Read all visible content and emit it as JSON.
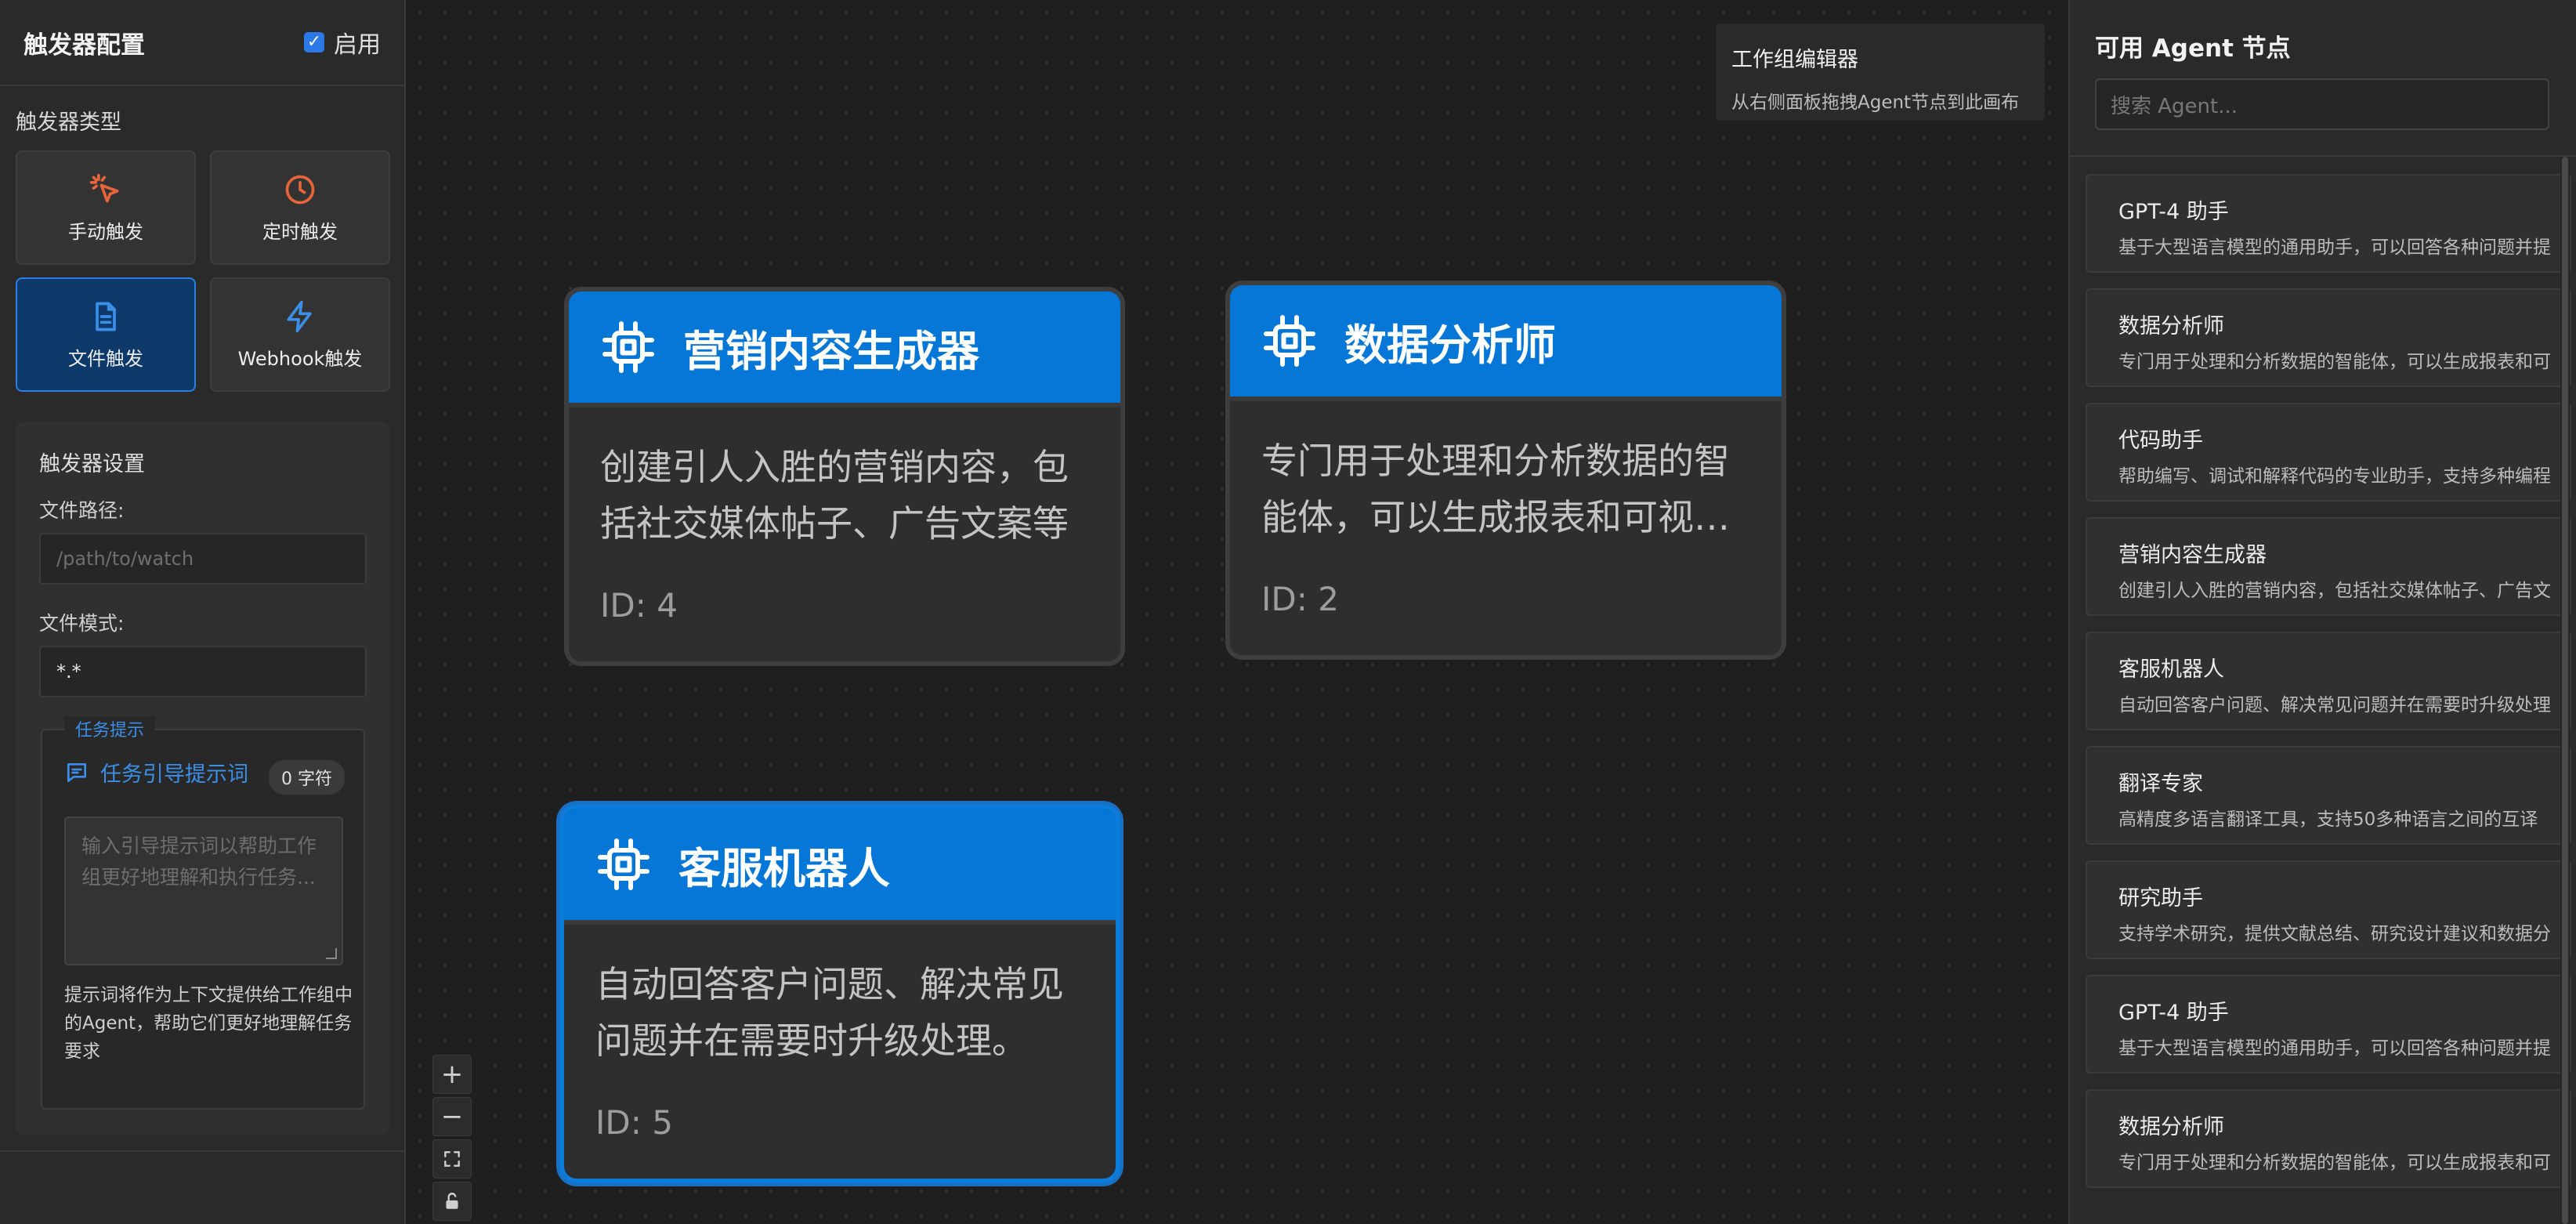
{
  "left_panel": {
    "title": "触发器配置",
    "enable_label": "启用",
    "trigger_type_label": "触发器类型",
    "triggers": [
      {
        "label": "手动触发",
        "icon": "cursor-click-icon",
        "color": "#e8643a"
      },
      {
        "label": "定时触发",
        "icon": "clock-icon",
        "color": "#e8643a"
      },
      {
        "label": "文件触发",
        "icon": "file-icon",
        "color": "#3b8fe8"
      },
      {
        "label": "Webhook触发",
        "icon": "bolt-icon",
        "color": "#3b8fe8"
      }
    ],
    "settings": {
      "title": "触发器设置",
      "file_path_label": "文件路径:",
      "file_path_placeholder": "/path/to/watch",
      "file_pattern_label": "文件模式:",
      "file_pattern_value": "*.*",
      "prompt": {
        "tag": "任务提示",
        "label": "任务引导提示词",
        "char_count": "0 字符",
        "placeholder": "输入引导提示词以帮助工作组更好地理解和执行任务...",
        "help": "提示词将作为上下文提供给工作组中的Agent，帮助它们更好地理解任务要求"
      }
    }
  },
  "canvas": {
    "tip": {
      "title": "工作组编辑器",
      "subtitle": "从右侧面板拖拽Agent节点到此画布"
    },
    "nodes": [
      {
        "title": "营销内容生成器",
        "description": "创建引人入胜的营销内容，包括社交媒体帖子、广告文案等",
        "id": "ID: 4"
      },
      {
        "title": "数据分析师",
        "description": "专门用于处理和分析数据的智能体，可以生成报表和可视化图表",
        "id": "ID: 2"
      },
      {
        "title": "客服机器人",
        "description": "自动回答客户问题、解决常见问题并在需要时升级处理。",
        "id": "ID: 5"
      }
    ],
    "zoom": {
      "in": "+",
      "out": "−"
    }
  },
  "right_panel": {
    "title": "可用 Agent 节点",
    "search_placeholder": "搜索 Agent...",
    "agents": [
      {
        "name": "GPT-4 助手",
        "description": "基于大型语言模型的通用助手，可以回答各种问题并提"
      },
      {
        "name": "数据分析师",
        "description": "专门用于处理和分析数据的智能体，可以生成报表和可"
      },
      {
        "name": "代码助手",
        "description": "帮助编写、调试和解释代码的专业助手，支持多种编程"
      },
      {
        "name": "营销内容生成器",
        "description": "创建引人入胜的营销内容，包括社交媒体帖子、广告文"
      },
      {
        "name": "客服机器人",
        "description": "自动回答客户问题、解决常见问题并在需要时升级处理"
      },
      {
        "name": "翻译专家",
        "description": "高精度多语言翻译工具，支持50多种语言之间的互译"
      },
      {
        "name": "研究助手",
        "description": "支持学术研究，提供文献总结、研究设计建议和数据分"
      },
      {
        "name": "GPT-4 助手",
        "description": "基于大型语言模型的通用助手，可以回答各种问题并提"
      },
      {
        "name": "数据分析师",
        "description": "专门用于处理和分析数据的智能体，可以生成报表和可"
      }
    ]
  }
}
